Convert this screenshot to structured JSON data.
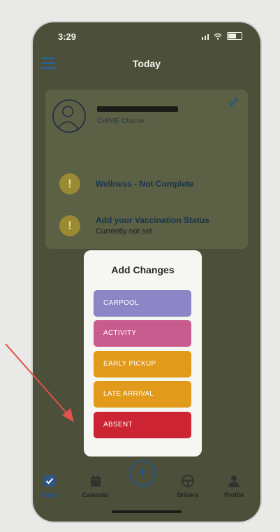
{
  "status_bar": {
    "time": "3:29"
  },
  "header": {
    "title": "Today"
  },
  "child_card": {
    "name": "",
    "group": "CHIME Charter"
  },
  "alerts": [
    {
      "title": "Wellness - Not Complete",
      "subtitle": ""
    },
    {
      "title": "Add your Vaccination Status",
      "subtitle": "Currently not set"
    }
  ],
  "popup": {
    "title": "Add Changes",
    "options": [
      {
        "label": "CARPOOL",
        "color": "#8c86c7"
      },
      {
        "label": "ACTIVITY",
        "color": "#c95c8f"
      },
      {
        "label": "EARLY PICKUP",
        "color": "#e29a1b"
      },
      {
        "label": "LATE ARRIVAL",
        "color": "#e29a1b"
      },
      {
        "label": "ABSENT",
        "color": "#cc2432"
      }
    ]
  },
  "tabs": [
    {
      "label": "Today",
      "icon": "checkbox-icon",
      "active": true
    },
    {
      "label": "Calendar",
      "icon": "calendar-icon",
      "active": false
    },
    {
      "label": "Drivers",
      "icon": "steering-wheel-icon",
      "active": false
    },
    {
      "label": "Profile",
      "icon": "person-icon",
      "active": false
    }
  ],
  "add_button_icon": "plus-icon",
  "annotation_arrow_color": "#e0524a"
}
